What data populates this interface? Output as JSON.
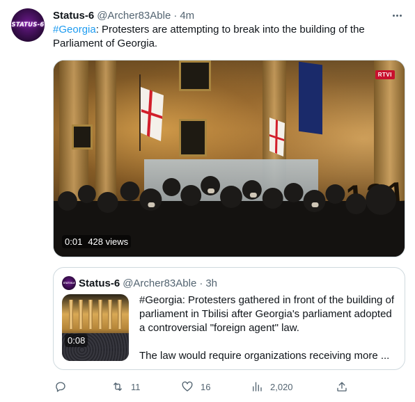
{
  "tweet": {
    "avatar_text": "STATUS-6",
    "display_name": "Status-6",
    "handle": "@Archer83Able",
    "separator": "·",
    "time": "4m",
    "hashtag": "#Georgia",
    "body": ": Protesters are attempting to break into the building of the Parliament of Georgia.",
    "media": {
      "watermark": "RTVI",
      "graffiti": "131",
      "duration": "0:01",
      "views": "428 views"
    }
  },
  "quoted_tweet": {
    "avatar_text": "STATUS-6",
    "display_name": "Status-6",
    "handle": "@Archer83Able",
    "separator": "·",
    "time": "3h",
    "media_duration": "0:08",
    "paragraph_1": "#Georgia: Protesters gathered in front of the building of parliament in Tbilisi after Georgia's parliament adopted a controversial \"foreign agent\" law.",
    "paragraph_2": "The law would require organizations receiving more ..."
  },
  "actions": {
    "replies": "",
    "retweets": "11",
    "likes": "16",
    "views": "2,020"
  },
  "icons": {
    "reply": "reply-icon",
    "retweet": "retweet-icon",
    "like": "heart-icon",
    "views": "views-chart-icon",
    "share": "share-icon",
    "more": "more-dots-icon"
  },
  "colors": {
    "link": "#1d9bf0",
    "text": "#0f1419",
    "secondary": "#536471",
    "border": "#cfd9de",
    "watermark_bg": "#c8102e"
  }
}
